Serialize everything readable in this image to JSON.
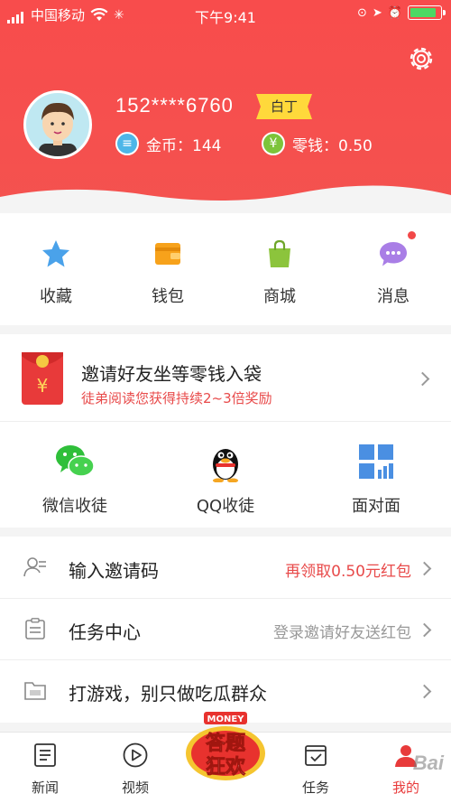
{
  "status_bar": {
    "carrier": "中国移动",
    "time": "下午9:41"
  },
  "profile": {
    "phone": "152****6760",
    "level_badge": "白丁",
    "coins_label": "金币：144",
    "change_label": "零钱：0.50"
  },
  "quick_actions": [
    {
      "label": "收藏",
      "icon": "star-icon"
    },
    {
      "label": "钱包",
      "icon": "wallet-icon"
    },
    {
      "label": "商城",
      "icon": "shopping-bag-icon"
    },
    {
      "label": "消息",
      "icon": "chat-bubble-icon"
    }
  ],
  "invite": {
    "title": "邀请好友坐等零钱入袋",
    "subtitle": "徒弟阅读您获得持续2~3倍奖励",
    "options": [
      {
        "label": "微信收徒",
        "icon": "wechat-icon"
      },
      {
        "label": "QQ收徒",
        "icon": "qq-penguin-icon"
      },
      {
        "label": "面对面",
        "icon": "qr-code-icon"
      }
    ]
  },
  "menu": [
    {
      "label": "输入邀请码",
      "value": "再领取0.50元红包",
      "value_color": "#e84a4a",
      "icon": "invite-code-icon"
    },
    {
      "label": "任务中心",
      "value": "登录邀请好友送红包",
      "value_color": "#999999",
      "icon": "task-clipboard-icon"
    },
    {
      "label": "打游戏，别只做吃瓜群众",
      "value": "",
      "value_color": "#999999",
      "icon": "ad-folder-icon"
    }
  ],
  "promo": {
    "top_text": "MONEY",
    "line1": "答题",
    "line2": "狂欢"
  },
  "tabs": [
    {
      "label": "新闻",
      "icon": "news-icon"
    },
    {
      "label": "视频",
      "icon": "video-play-icon"
    },
    {
      "label": "任务",
      "icon": "task-icon"
    },
    {
      "label": "我的",
      "icon": "profile-icon"
    }
  ],
  "watermark": "Bai",
  "colors": {
    "brand_red": "#f84c4c",
    "badge_yellow": "#ffd93b",
    "accent_red": "#e84a4a"
  }
}
